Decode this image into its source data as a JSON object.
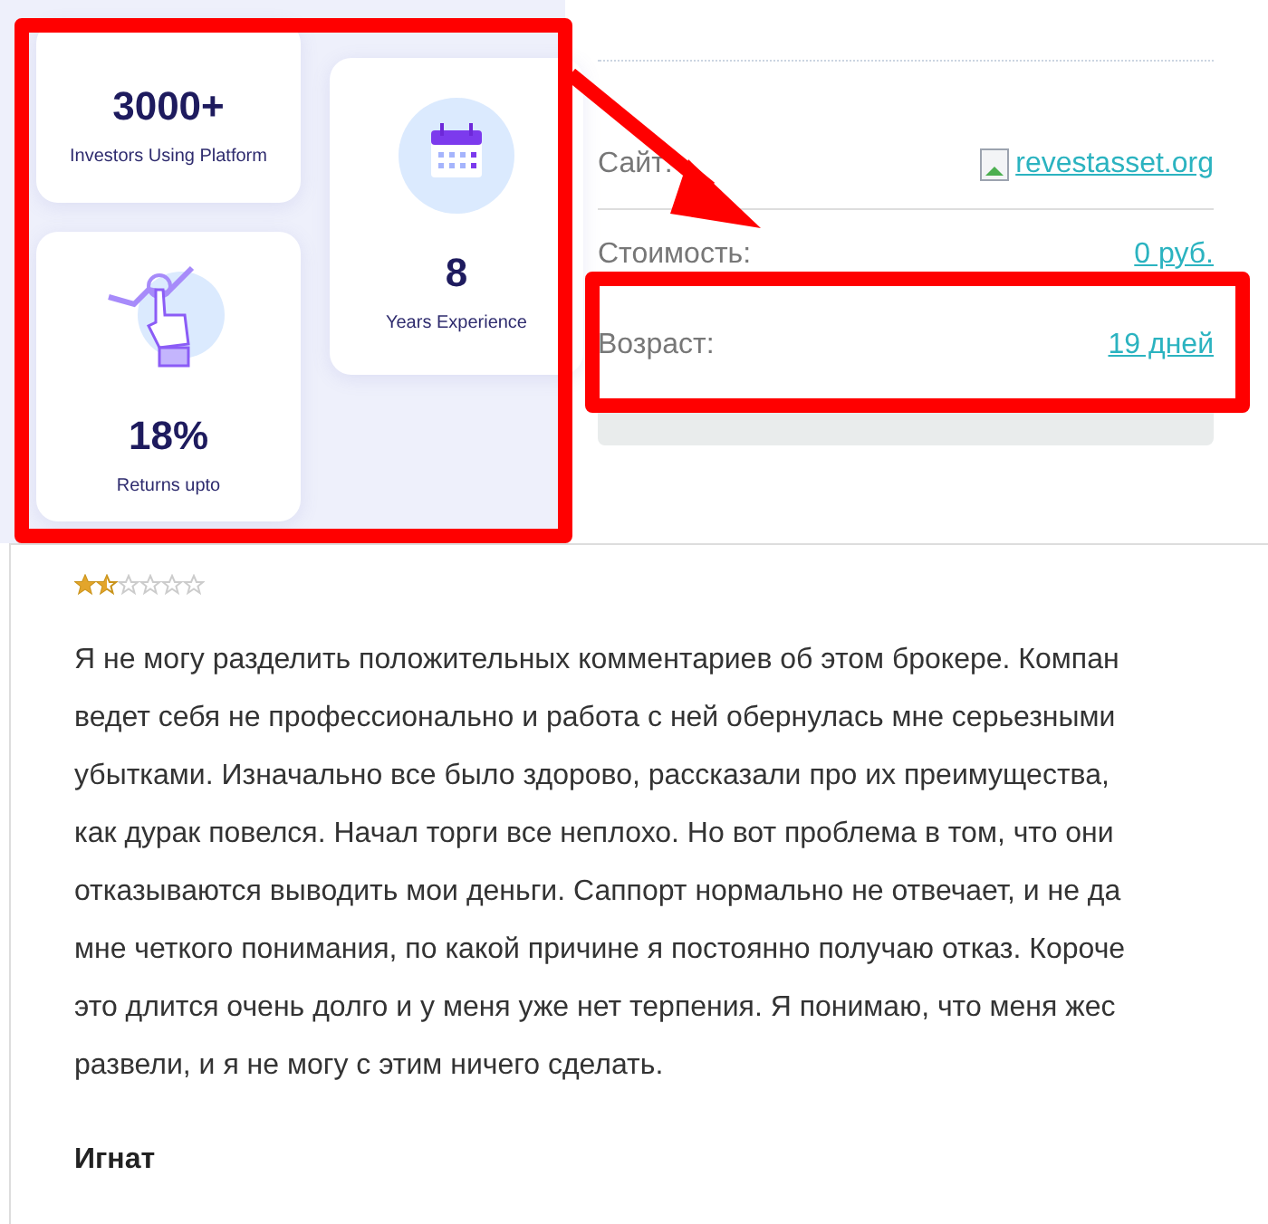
{
  "stats": [
    {
      "kind": "plain",
      "value": "3000+",
      "label": "Investors Using Platform"
    },
    {
      "kind": "hand",
      "value": "18%",
      "label": "Returns upto"
    },
    {
      "kind": "calendar",
      "value": "8",
      "label": "Years Experience"
    }
  ],
  "info_rows": [
    {
      "label": "Сайт:",
      "value": "revestasset.org",
      "kind": "site"
    },
    {
      "label": "Стоимость:",
      "value": "0 руб.",
      "kind": "plain"
    },
    {
      "label": "Возраст:",
      "value": "19 дней",
      "kind": "plain"
    }
  ],
  "review": {
    "stars": 1.5,
    "lines": [
      "Я не могу разделить положительных комментариев об этом брокере. Компан",
      "ведет себя не профессионально и работа с ней обернулась мне серьезными",
      "убытками. Изначально все было здорово, рассказали про их преимущества,",
      "как дурак повелся. Начал торги все неплохо. Но вот проблема в том, что они",
      "отказываются выводить мои деньги. Саппорт нормально не отвечает, и не да",
      "мне четкого понимания, по какой причине я постоянно получаю отказ. Короче",
      "это длится очень долго и у меня уже нет терпения. Я понимаю, что меня жес",
      "развели, и я не могу с этим ничего сделать."
    ],
    "author": "Игнат"
  }
}
